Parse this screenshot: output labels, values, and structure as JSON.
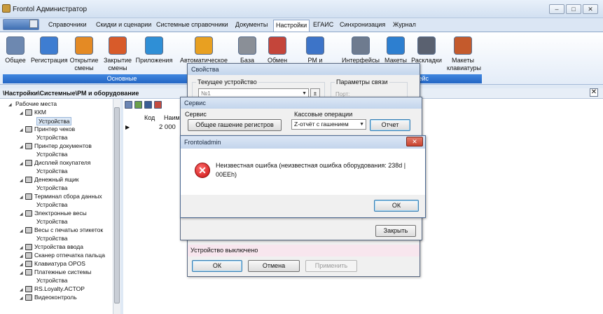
{
  "window": {
    "title": "Frontol Администратор"
  },
  "menu_tabs": [
    "Справочники",
    "Скидки и сценарии",
    "Системные справочники",
    "Документы",
    "Настройки",
    "ЕГАИС",
    "Синхронизация",
    "Журнал"
  ],
  "ribbon": {
    "buttons": [
      {
        "label": "Общее",
        "icon": "general-settings-icon",
        "color": "#6d88b0"
      },
      {
        "label": "Регистрация",
        "icon": "registration-icon",
        "color": "#3e7dd1"
      },
      {
        "label": "Открытие\nсмены",
        "icon": "open-shift-icon",
        "color": "#e48a24"
      },
      {
        "label": "Закрытие\nсмены",
        "icon": "close-shift-icon",
        "color": "#d85b2a"
      },
      {
        "label": "Приложения",
        "icon": "applications-icon",
        "color": "#2f8fd6"
      },
      {
        "label": "Автоматическое",
        "icon": "automatic-icon",
        "color": "#e8a021"
      },
      {
        "label": "База",
        "icon": "database-icon",
        "color": "#8a8f97"
      },
      {
        "label": "Обмен",
        "icon": "exchange-icon",
        "color": "#c4453a"
      },
      {
        "label": "РМ и",
        "icon": "workplace-icon",
        "color": "#3d74c8"
      },
      {
        "label": "Интерфейсы",
        "icon": "interfaces-icon",
        "color": "#6e7b8f"
      },
      {
        "label": "Макеты",
        "icon": "layouts-icon",
        "color": "#2d7fd0"
      },
      {
        "label": "Раскладки",
        "icon": "keyboard-layouts-icon",
        "color": "#5a6170"
      },
      {
        "label": "Макеты\nклавиатуры",
        "icon": "keyboard-macros-icon",
        "color": "#c45a2c"
      }
    ],
    "groups": [
      "Основные",
      "фейс"
    ]
  },
  "path": "\\Настройки\\Системные\\РМ и оборудование",
  "tree": [
    {
      "label": "Рабочие места",
      "level": 0,
      "icon": "workstation-icon"
    },
    {
      "label": "ККМ",
      "level": 1,
      "icon": "cash-register-icon"
    },
    {
      "label": "Устройства",
      "level": 2,
      "selected": true
    },
    {
      "label": "Принтер чеков",
      "level": 1,
      "icon": "receipt-printer-icon"
    },
    {
      "label": "Устройства",
      "level": 2
    },
    {
      "label": "Принтер документов",
      "level": 1,
      "icon": "document-printer-icon"
    },
    {
      "label": "Устройства",
      "level": 2
    },
    {
      "label": "Дисплей покупателя",
      "level": 1,
      "icon": "customer-display-icon"
    },
    {
      "label": "Устройства",
      "level": 2
    },
    {
      "label": "Денежный ящик",
      "level": 1,
      "icon": "cash-drawer-icon"
    },
    {
      "label": "Устройства",
      "level": 2
    },
    {
      "label": "Терминал сбора данных",
      "level": 1,
      "icon": "data-terminal-icon"
    },
    {
      "label": "Устройства",
      "level": 2
    },
    {
      "label": "Электронные весы",
      "level": 1,
      "icon": "scales-icon"
    },
    {
      "label": "Устройства",
      "level": 2
    },
    {
      "label": "Весы с печатью этикеток",
      "level": 1,
      "icon": "label-scales-icon"
    },
    {
      "label": "Устройства",
      "level": 2
    },
    {
      "label": "Устройства ввода",
      "level": 1,
      "icon": "input-device-icon"
    },
    {
      "label": "Сканер отпечатка пальца",
      "level": 1,
      "icon": "fingerprint-scanner-icon"
    },
    {
      "label": "Клавиатура OPOS",
      "level": 1,
      "icon": "opos-keyboard-icon"
    },
    {
      "label": "Платежные системы",
      "level": 1,
      "icon": "payment-systems-icon"
    },
    {
      "label": "Устройства",
      "level": 2
    },
    {
      "label": "RS.Loyalty.ACTOP",
      "level": 1,
      "icon": "loyalty-icon"
    },
    {
      "label": "Видеоконтроль",
      "level": 1,
      "icon": "video-control-icon"
    }
  ],
  "grid": {
    "columns": [
      "Код",
      "Наим"
    ],
    "rows": [
      {
        "code": "2 000"
      }
    ]
  },
  "props_dialog": {
    "title": "Свойства",
    "current_device_label": "Текущее устройство",
    "device_value": "№1",
    "stepper": "±",
    "link_params_label": "Параметры связи",
    "port_label": "Порт:",
    "status": "Устройство выключено",
    "ok": "ОК",
    "cancel": "Отмена",
    "apply": "Применить"
  },
  "service_dialog": {
    "title": "Сервис",
    "service_group": "Сервис",
    "reset_registers": "Общее гашение регистров",
    "cash_ops_group": "Кассовые операции",
    "report_value": "Z-отчёт с гашением",
    "report_button": "Отчет",
    "close": "Закрыть"
  },
  "error_dialog": {
    "title": "Frontoladmin",
    "message": "Неизвестная ошибка (неизвестная ошибка оборудования: 238d | 00EEh)",
    "ok": "ОК",
    "close_glyph": "✕"
  },
  "colors": {
    "accent": "#2466c4",
    "error": "#c80f0f",
    "close_button": "#c8432f"
  }
}
